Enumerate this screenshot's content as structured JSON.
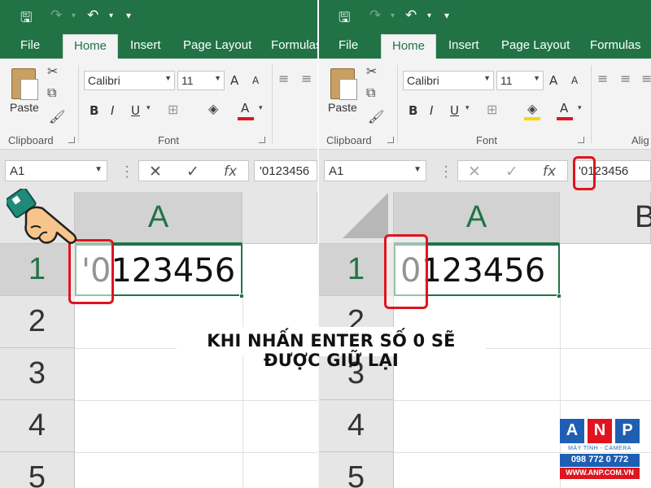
{
  "qat": {
    "save_icon": "save-icon",
    "redo_icon": "redo-icon",
    "undo_icon": "undo-icon",
    "customize_icon": "chevron-down-icon"
  },
  "tabs": [
    "File",
    "Home",
    "Insert",
    "Page Layout",
    "Formulas"
  ],
  "ribbon": {
    "paste_label": "Paste",
    "clipboard_label": "Clipboard",
    "font_group_label": "Font",
    "alignment_label_partial": "Alig",
    "font_name": "Calibri",
    "font_size": "11",
    "bold": "B",
    "italic": "I",
    "underline": "U",
    "font_color_glyph": "A",
    "grow_glyph": "A",
    "shrink_glyph": "A",
    "font_color": "#e0141e",
    "fill_color": "#ffd400"
  },
  "formula_bar": {
    "name_box": "A1",
    "cancel_glyph": "✕",
    "enter_glyph": "✓",
    "fx_label": "fx",
    "left_content": "'0123456",
    "right_content": "'0123456"
  },
  "grid": {
    "col_a": "A",
    "col_b": "B",
    "rows": [
      "1",
      "2",
      "3",
      "4",
      "5"
    ],
    "left_a1": "'0123456",
    "right_a1": "0123456"
  },
  "caption": "KHI NHẤN ENTER SỐ 0 SẼ ĐƯỢC GIỮ LẠI",
  "logo": {
    "letters": [
      "A",
      "N",
      "P"
    ],
    "letter_colors": [
      "#1e5fb4",
      "#e0141e",
      "#1e5fb4"
    ],
    "tagline": "MÁY TÍNH - CAMERA",
    "phone": "098 772 0 772",
    "website": "WWW.ANP.COM.VN"
  },
  "theme": {
    "excel_green": "#217346",
    "highlight_red": "#e0141e"
  }
}
